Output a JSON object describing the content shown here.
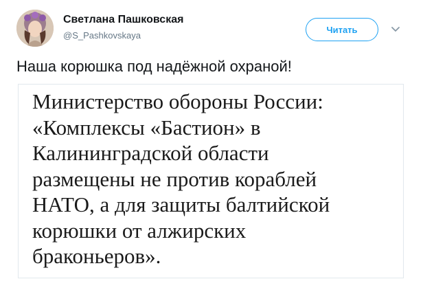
{
  "author": {
    "name": "Светлана Пашковская",
    "handle": "@S_Pashkovskaya"
  },
  "follow_button": {
    "label": "Читать"
  },
  "tweet": {
    "text": "Наша корюшка под надёжной охраной!"
  },
  "quote_image": {
    "lines": [
      "Министерство обороны России:",
      "«Комплексы «Бастион» в",
      "Калининградской области",
      "размещены не против кораблей",
      "НАТО, а для защиты балтийской",
      "корюшки от алжирских",
      "браконьеров»."
    ]
  },
  "colors": {
    "accent": "#1da1f2",
    "name_text": "#14171a",
    "handle_text": "#657786",
    "border": "#e1e8ed"
  },
  "icons": {
    "caret": "chevron-down-icon",
    "avatar": "avatar"
  }
}
